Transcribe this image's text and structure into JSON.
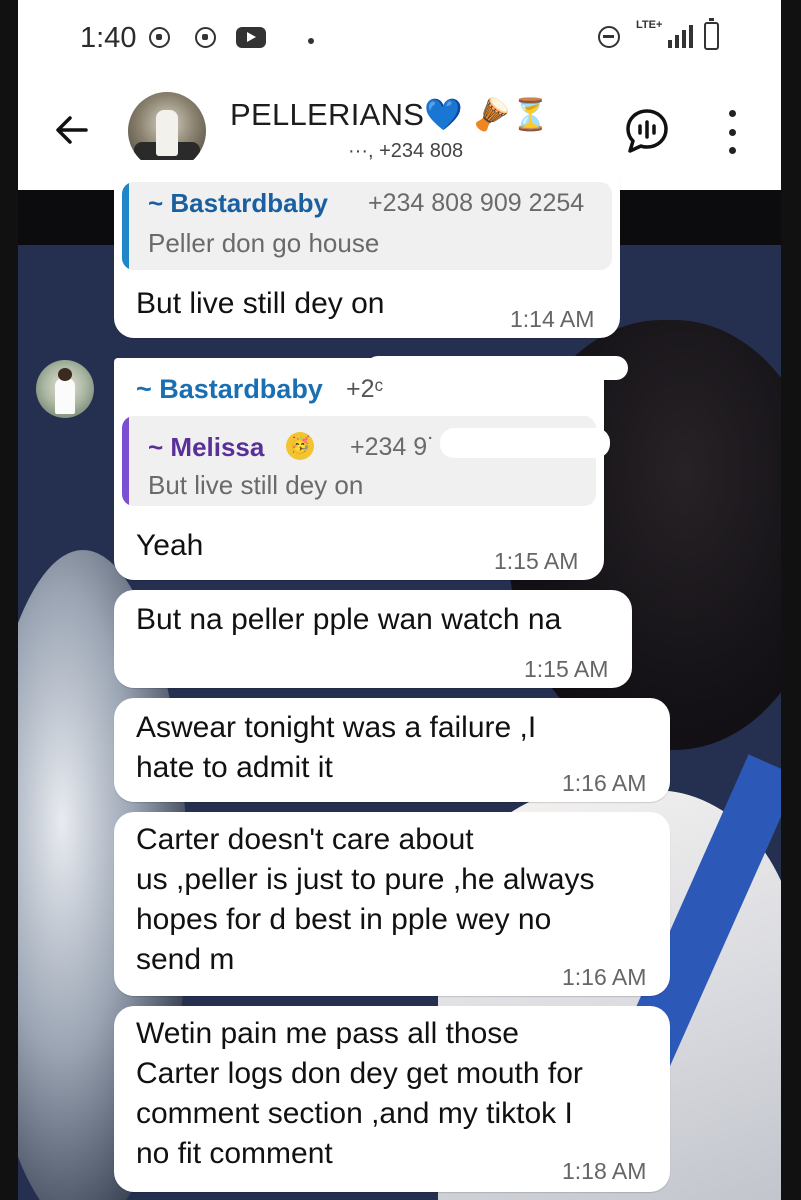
{
  "status_bar": {
    "time": "1:40",
    "network": "LTE+"
  },
  "header": {
    "group_name": "PELLERIANS💙 🪘⏳",
    "participants_partial": "···, +234 808"
  },
  "messages": [
    {
      "id": "m1",
      "quote": {
        "name": "~ Bastardbaby",
        "phone": "+234 808 909 2254",
        "text": "Peller don go house",
        "bar_color": "#1f86c8",
        "name_color": "#1a5fa0"
      },
      "text": "But live still dey on",
      "time": "1:14 AM"
    },
    {
      "id": "m2",
      "sender": "~ Bastardbaby",
      "sender_phone": "+2ᶜ",
      "quote": {
        "name": "~ Melissa",
        "emoji": "🥳",
        "phone": "+234 9˙",
        "text": "But live still dey on",
        "bar_color": "#7b4fd0",
        "name_color": "#5a2f98"
      },
      "text": "Yeah",
      "time": "1:15 AM"
    },
    {
      "id": "m3",
      "text": "But na peller pple wan watch na",
      "time": "1:15 AM"
    },
    {
      "id": "m4",
      "text": "Aswear tonight was a failure ,I\nhate to admit it",
      "time": "1:16 AM"
    },
    {
      "id": "m5",
      "text": "Carter doesn't care about\nus ,peller is just to pure ,he always\nhopes for d best in pple wey no\nsend m",
      "time": "1:16 AM"
    },
    {
      "id": "m6",
      "text": "Wetin pain me pass all those\nCarter logs don dey get mouth for\ncomment section ,and my tiktok I\nno fit comment",
      "time": "1:18 AM"
    }
  ]
}
